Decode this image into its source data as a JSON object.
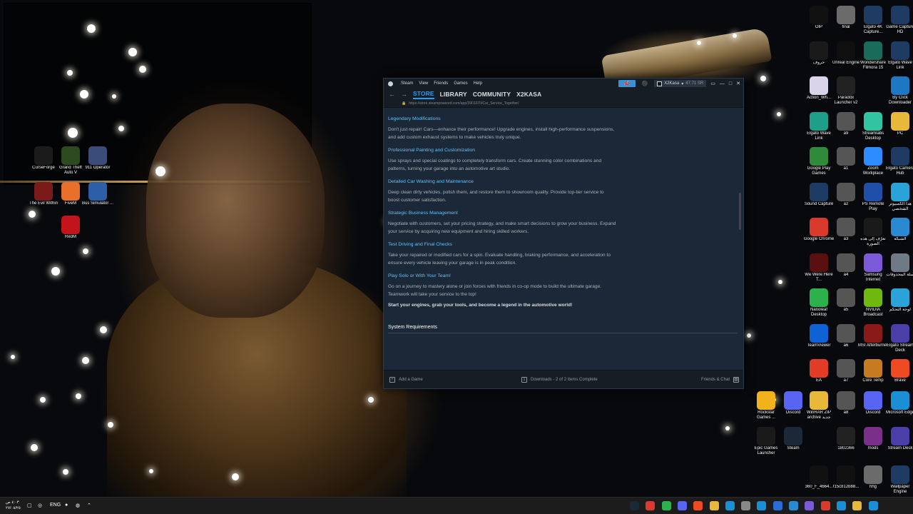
{
  "desktop": {
    "left_icons": [
      {
        "label": "CurseForge",
        "icon": "curseforge-icon",
        "color": "#1b1b1b"
      },
      {
        "label": "Grand Theft Auto V",
        "icon": "gta-icon",
        "color": "#2d4a1e"
      },
      {
        "label": "911 Operator",
        "icon": "911-icon",
        "color": "#3b4c7a"
      },
      {
        "label": "The Evil Within",
        "icon": "evil-within-icon",
        "color": "#7a1a1a"
      },
      {
        "label": "FiveM",
        "icon": "fivem-icon",
        "color": "#e8702a"
      },
      {
        "label": "Bus Simulator ...",
        "icon": "bus-icon",
        "color": "#2c5fa8"
      },
      {
        "label": "RedM",
        "icon": "redm-icon",
        "color": "#c2141b"
      }
    ],
    "right_icons": [
      {
        "label": "OIP",
        "icon": "image-icon",
        "color": "#111111"
      },
      {
        "label": "final",
        "icon": "image-icon",
        "color": "#6b6b6b"
      },
      {
        "label": "Elgato 4K Capture...",
        "icon": "elgato-icon",
        "color": "#1e3b64"
      },
      {
        "label": "Game Capture HD",
        "icon": "elgato-icon",
        "color": "#1e3b64"
      },
      {
        "label": "حروف",
        "icon": "text-icon",
        "color": "#1a1a1a"
      },
      {
        "label": "Unreal Engine",
        "icon": "unreal-icon",
        "color": "#0f0f0f"
      },
      {
        "label": "Wondershare Filmora 15",
        "icon": "filmora-icon",
        "color": "#1b6b5a"
      },
      {
        "label": "Elgato Wave Link",
        "icon": "elgato-icon",
        "color": "#1e3b64"
      },
      {
        "label": "Action_Wh...",
        "icon": "file-icon",
        "color": "#d9d4ea"
      },
      {
        "label": "Paradox Launcher v2",
        "icon": "paradox-icon",
        "color": "#222222"
      },
      {
        "label": "",
        "icon": "blank-icon",
        "color": "rgba(0,0,0,0)"
      },
      {
        "label": "By Click Downloader",
        "icon": "download-icon",
        "color": "#1d77c2"
      },
      {
        "label": "Elgato Wave Link",
        "icon": "elgato-icon",
        "color": "#1f9e8a"
      },
      {
        "label": "a9",
        "icon": "image-icon",
        "color": "#555555"
      },
      {
        "label": "Streamlabs Desktop",
        "icon": "streamlabs-icon",
        "color": "#31c3a2"
      },
      {
        "label": "PC",
        "icon": "folder-icon",
        "color": "#e8b83a"
      },
      {
        "label": "Google Play Games",
        "icon": "play-games-icon",
        "color": "#2f8a3a"
      },
      {
        "label": "a1",
        "icon": "image-icon",
        "color": "#555555"
      },
      {
        "label": "Zoom Workplace",
        "icon": "zoom-icon",
        "color": "#2d8cff"
      },
      {
        "label": "Elgato Camera Hub",
        "icon": "camera-icon",
        "color": "#1e3b64"
      },
      {
        "label": "Sound Capture",
        "icon": "sound-icon",
        "color": "#1e3b64"
      },
      {
        "label": "a2",
        "icon": "image-icon",
        "color": "#555555"
      },
      {
        "label": "PS Remote Play",
        "icon": "ps-icon",
        "color": "#1f4fa8"
      },
      {
        "label": "هذا الكمبيوتر الشخصي",
        "icon": "monitor-icon",
        "color": "#2aa3d9"
      },
      {
        "label": "Google Chrome",
        "icon": "chrome-icon",
        "color": "#d93a2b"
      },
      {
        "label": "a3",
        "icon": "image-icon",
        "color": "#555555"
      },
      {
        "label": "تعرّف إلى هذه الصورة",
        "icon": "info-icon",
        "color": "#1a1a1a"
      },
      {
        "label": "الشبكة",
        "icon": "network-icon",
        "color": "#2a8ad1"
      },
      {
        "label": "We Were Here T...",
        "icon": "game-icon",
        "color": "#5a1010"
      },
      {
        "label": "a4",
        "icon": "image-icon",
        "color": "#555555"
      },
      {
        "label": "Samsung Internet",
        "icon": "samsung-icon",
        "color": "#7a5ad8"
      },
      {
        "label": "سلة المحذوفات",
        "icon": "recycle-bin-icon",
        "color": "#6f7a86"
      },
      {
        "label": "Nanoleaf Desktop",
        "icon": "nanoleaf-icon",
        "color": "#2bb24c"
      },
      {
        "label": "a5",
        "icon": "image-icon",
        "color": "#555555"
      },
      {
        "label": "NVIDIA Broadcast",
        "icon": "nvidia-icon",
        "color": "#6eb80f"
      },
      {
        "label": "لوحة التحكم",
        "icon": "control-panel-icon",
        "color": "#2aa3d9"
      },
      {
        "label": "TeamViewer",
        "icon": "teamviewer-icon",
        "color": "#0e62d6"
      },
      {
        "label": "a6",
        "icon": "image-icon",
        "color": "#555555"
      },
      {
        "label": "MSI Afterburner",
        "icon": "msi-icon",
        "color": "#8a1a1a"
      },
      {
        "label": "Elgato Stream Deck",
        "icon": "stream-deck-icon",
        "color": "#4a3fa8"
      },
      {
        "label": "EA",
        "icon": "ea-icon",
        "color": "#e23b26"
      },
      {
        "label": "a7",
        "icon": "image-icon",
        "color": "#555555"
      },
      {
        "label": "Core Temp",
        "icon": "core-temp-icon",
        "color": "#c77b20"
      },
      {
        "label": "Brave",
        "icon": "brave-icon",
        "color": "#f04a23"
      },
      {
        "label": "Rockstar Games ...",
        "icon": "rockstar-icon",
        "color": "#f2b21c"
      },
      {
        "label": "Discord",
        "icon": "discord-icon",
        "color": "#5865f2"
      },
      {
        "label": "WinRAR ZIP archive جديد",
        "icon": "folder-icon",
        "color": "#e8b83a"
      },
      {
        "label": "a8",
        "icon": "image-icon",
        "color": "#555555"
      },
      {
        "label": "Discord",
        "icon": "discord-icon",
        "color": "#5865f2"
      },
      {
        "label": "Microsoft Edge",
        "icon": "edge-icon",
        "color": "#1a8fd6"
      },
      {
        "label": "Epic Games Launcher",
        "icon": "epic-icon",
        "color": "#1a1a1a"
      },
      {
        "label": "Steam",
        "icon": "steam-icon",
        "color": "#1b2838"
      },
      {
        "label": "",
        "icon": "blank-icon",
        "color": "rgba(0,0,0,0)"
      },
      {
        "label": "1802366",
        "icon": "image-icon",
        "color": "#222222"
      },
      {
        "label": "mods",
        "icon": "winrar-icon",
        "color": "#7a2f8a"
      },
      {
        "label": "Stream Deck",
        "icon": "stream-deck-icon",
        "color": "#4a3fa8"
      },
      {
        "label": "360_F_4664...",
        "icon": "image-icon",
        "color": "#111111"
      },
      {
        "label": "f15c812b88...",
        "icon": "image-icon",
        "color": "#111111"
      },
      {
        "label": "hhg",
        "icon": "image-icon",
        "color": "#6b6b6b"
      },
      {
        "label": "Wallpaper Engine",
        "icon": "wallpaper-engine-icon",
        "color": "#1e3b64"
      }
    ]
  },
  "steam": {
    "menu": [
      "Steam",
      "View",
      "Friends",
      "Games",
      "Help"
    ],
    "account_name": "X2Kasa",
    "wallet": "47.71 SR",
    "nav_tabs": [
      "STORE",
      "LIBRARY",
      "COMMUNITY",
      "X2KASA"
    ],
    "url": "https://store.steampowered.com/app/3901070/Car_Service_Together/",
    "sections": [
      {
        "title": "Legendary Modifications",
        "body": "Don't just repair! Cars—enhance their performance! Upgrade engines, install high-performance suspensions, and add custom exhaust systems to make vehicles truly unique."
      },
      {
        "title": "Professional Painting and Customization",
        "body": "Use sprays and special coatings to completely transform cars. Create stunning color combinations and patterns, turning your garage into an automotive art studio."
      },
      {
        "title": "Detailed Car Washing and Maintenance",
        "body": "Deep clean dirty vehicles, polish them, and restore them to showroom quality. Provide top-tier service to boost customer satisfaction."
      },
      {
        "title": "Strategic Business Management",
        "body": "Negotiate with customers, set your pricing strategy, and make smart decisions to grow your business. Expand your service by acquiring new equipment and hiring skilled workers."
      },
      {
        "title": "Test Driving and Final Checks",
        "body": "Take your repaired or modified cars for a spin. Evaluate handling, braking performance, and acceleration to ensure every vehicle leaving your garage is in peak condition."
      },
      {
        "title": "Play Solo or With Your Team!",
        "body": "Go on a journey to mastery alone or join forces with friends in co-op mode to build the ultimate garage. Teamwork will take your service to the top!"
      }
    ],
    "closing": "Start your engines, grab your tools, and become a legend in the automotive world!",
    "system_requirements": "System Requirements",
    "add_game": "Add a Game",
    "downloads": "Downloads - 2 of 2 Items Complete",
    "friends_chat": "Friends & Chat"
  },
  "taskbar": {
    "time": "٤:٠٣ ص",
    "date": "٢٧/٠٨/٢٥",
    "language": "ENG",
    "icons": [
      {
        "name": "steam-taskbar-icon",
        "color": "#1b2838"
      },
      {
        "name": "chrome-taskbar-icon",
        "color": "#d93a2b"
      },
      {
        "name": "nanoleaf-taskbar-icon",
        "color": "#2bb24c"
      },
      {
        "name": "discord-taskbar-icon",
        "color": "#5865f2"
      },
      {
        "name": "brave-taskbar-icon",
        "color": "#f04a23"
      },
      {
        "name": "explorer-taskbar-icon",
        "color": "#e8b83a"
      },
      {
        "name": "wallpaper-taskbar-icon",
        "color": "#1a8fd6"
      },
      {
        "name": "settings-taskbar-icon",
        "color": "#888888"
      },
      {
        "name": "edge-taskbar-icon",
        "color": "#1a8fd6"
      },
      {
        "name": "store-taskbar-icon",
        "color": "#2d6bd6"
      },
      {
        "name": "mail-taskbar-icon",
        "color": "#2a8ad1"
      },
      {
        "name": "app-taskbar-icon",
        "color": "#7a5ad8"
      },
      {
        "name": "chrome-2-taskbar-icon",
        "color": "#d93a2b"
      },
      {
        "name": "edge-2-taskbar-icon",
        "color": "#1a8fd6"
      },
      {
        "name": "files-taskbar-icon",
        "color": "#e8b83a"
      },
      {
        "name": "windows-taskbar-icon",
        "color": "#1a8fd6"
      }
    ]
  }
}
